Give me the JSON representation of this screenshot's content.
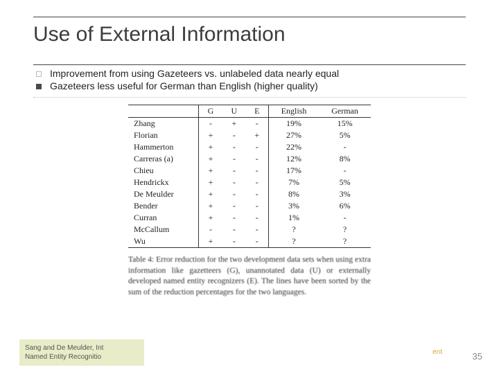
{
  "title": "Use of External Information",
  "bullets": [
    "Improvement from using  Gazeteers vs. unlabeled data nearly equal",
    "Gazeteers less useful for German than English (higher quality)"
  ],
  "chart_data": {
    "type": "table",
    "columns": [
      "G",
      "U",
      "E",
      "English",
      "German"
    ],
    "rows": [
      {
        "name": "Zhang",
        "G": "-",
        "U": "+",
        "E": "-",
        "English": "19%",
        "German": "15%"
      },
      {
        "name": "Florian",
        "G": "+",
        "U": "-",
        "E": "+",
        "English": "27%",
        "German": "5%"
      },
      {
        "name": "Hammerton",
        "G": "+",
        "U": "-",
        "E": "-",
        "English": "22%",
        "German": "-"
      },
      {
        "name": "Carreras (a)",
        "G": "+",
        "U": "-",
        "E": "-",
        "English": "12%",
        "German": "8%"
      },
      {
        "name": "Chieu",
        "G": "+",
        "U": "-",
        "E": "-",
        "English": "17%",
        "German": "-"
      },
      {
        "name": "Hendrickx",
        "G": "+",
        "U": "-",
        "E": "-",
        "English": "7%",
        "German": "5%"
      },
      {
        "name": "De Meulder",
        "G": "+",
        "U": "-",
        "E": "-",
        "English": "8%",
        "German": "3%"
      },
      {
        "name": "Bender",
        "G": "+",
        "U": "-",
        "E": "-",
        "English": "3%",
        "German": "6%"
      },
      {
        "name": "Curran",
        "G": "+",
        "U": "-",
        "E": "-",
        "English": "1%",
        "German": "-"
      },
      {
        "name": "McCallum",
        "G": "-",
        "U": "-",
        "E": "-",
        "English": "?",
        "German": "?"
      },
      {
        "name": "Wu",
        "G": "+",
        "U": "-",
        "E": "-",
        "English": "?",
        "German": "?"
      }
    ]
  },
  "table_title": "Table 4:",
  "caption": "Error reduction for the two development data sets when using extra information like gazetteers (G), unannotated data (U) or externally developed named entity recognizers (E). The lines have been sorted by the sum of the reduction percentages for the two languages.",
  "footer": {
    "cite_line1": "Sang and De Meulder, Int",
    "cite_line2": "Named Entity Recognitio",
    "right_fragment": "ent",
    "page": "35"
  }
}
